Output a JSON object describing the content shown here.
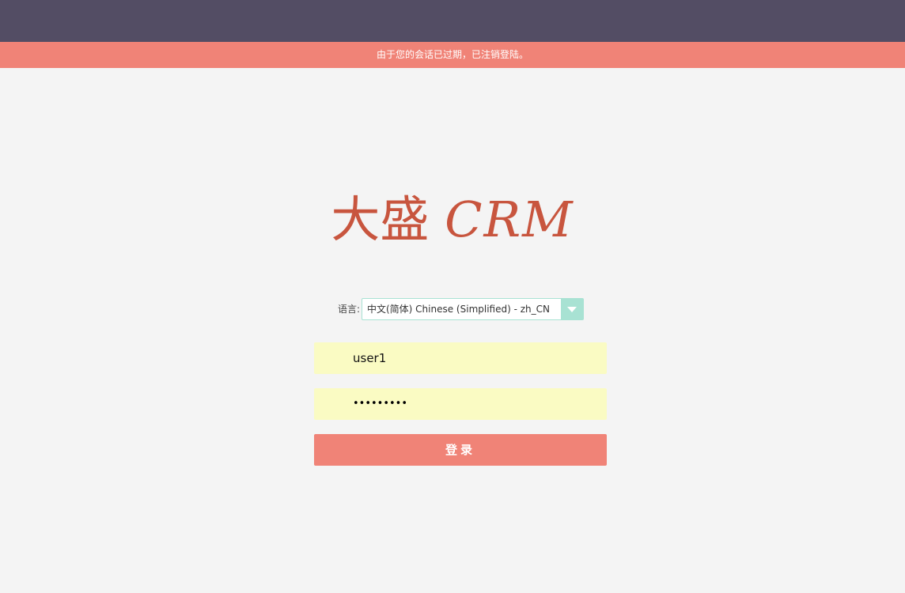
{
  "alert": {
    "message": "由于您的会话已过期，已注销登陆。"
  },
  "logo": {
    "cjk": "大盛",
    "latin": "CRM"
  },
  "language": {
    "label": "语言:",
    "selected": "中文(简体) Chinese (Simplified) - zh_CN",
    "toggle_icon": "chevron-down-icon"
  },
  "login_form": {
    "username_value": "user1",
    "password_masked": "•••••••••",
    "submit_label": "登录"
  },
  "colors": {
    "top_bar": "#534d64",
    "alert": "#f08377",
    "logo": "#c8553e",
    "select_accent": "#a8e2d3",
    "input_background": "#fafbc3",
    "button": "#f08377",
    "page_background": "#f4f4f4"
  }
}
